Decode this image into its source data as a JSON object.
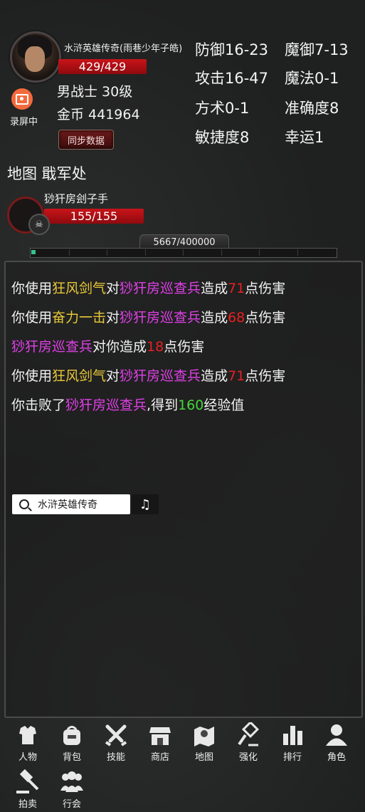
{
  "player": {
    "name": "水浒英雄传奇(雨巷少年子皓)",
    "hp": "429/429",
    "class_level": "男战士 30级",
    "gold": "金币 441964",
    "record_label": "录屏中",
    "sync_button": "同步数据"
  },
  "stats": {
    "defense": "防御16-23",
    "magic_defense": "魔御7-13",
    "attack": "攻击16-47",
    "magic": "魔法0-1",
    "taoism": "方术0-1",
    "accuracy": "准确度8",
    "agility": "敏捷度8",
    "luck": "幸运1"
  },
  "map": {
    "label": "地图 戢军处"
  },
  "enemy": {
    "name": "猀犴房刽子手",
    "hp": "155/155"
  },
  "experience": {
    "text": "5667/400000",
    "progress_fraction": 0.014
  },
  "battle_log": [
    {
      "parts": [
        [
          "你使用",
          ""
        ],
        [
          "狂风剑气",
          "skill"
        ],
        [
          "对",
          ""
        ],
        [
          "猀犴房巡查兵",
          "enemy"
        ],
        [
          "造成",
          ""
        ],
        [
          "71",
          "dmg"
        ],
        [
          "点伤害",
          ""
        ]
      ]
    },
    {
      "parts": [
        [
          "你使用",
          ""
        ],
        [
          "奋力一击",
          "skill"
        ],
        [
          "对",
          ""
        ],
        [
          "猀犴房巡查兵",
          "enemy"
        ],
        [
          "造成",
          ""
        ],
        [
          "68",
          "dmg"
        ],
        [
          "点伤害",
          ""
        ]
      ]
    },
    {
      "parts": [
        [
          "猀犴房巡查兵",
          "enemy"
        ],
        [
          "对你造成",
          ""
        ],
        [
          "18",
          "dmg"
        ],
        [
          "点伤害",
          ""
        ]
      ]
    },
    {
      "parts": [
        [
          "你使用",
          ""
        ],
        [
          "狂风剑气",
          "skill"
        ],
        [
          "对",
          ""
        ],
        [
          "猀犴房巡查兵",
          "enemy"
        ],
        [
          "造成",
          ""
        ],
        [
          "71",
          "dmg"
        ],
        [
          "点伤害",
          ""
        ]
      ]
    },
    {
      "parts": [
        [
          "你击败了",
          ""
        ],
        [
          "猀犴房巡查兵",
          "enemy"
        ],
        [
          ",得到",
          ""
        ],
        [
          "160",
          "exp"
        ],
        [
          "经验值",
          ""
        ]
      ]
    }
  ],
  "search": {
    "text": "水浒英雄传奇"
  },
  "nav": {
    "row1": [
      {
        "label": "人物",
        "icon": "armor-icon"
      },
      {
        "label": "背包",
        "icon": "bag-icon"
      },
      {
        "label": "技能",
        "icon": "swords-icon"
      },
      {
        "label": "商店",
        "icon": "shop-icon"
      },
      {
        "label": "地图",
        "icon": "map-icon"
      },
      {
        "label": "强化",
        "icon": "hammer-icon"
      },
      {
        "label": "排行",
        "icon": "chart-icon"
      },
      {
        "label": "角色",
        "icon": "user-icon"
      }
    ],
    "row2": [
      {
        "label": "拍卖",
        "icon": "gavel-icon"
      },
      {
        "label": "行会",
        "icon": "group-icon"
      }
    ]
  },
  "colors": {
    "hp_red": "#c8141a",
    "skill_yellow": "#e8c838",
    "enemy_magenta": "#e040e8",
    "damage_red": "#e82020",
    "exp_green": "#44d83a",
    "record_orange": "#f36a3c"
  }
}
